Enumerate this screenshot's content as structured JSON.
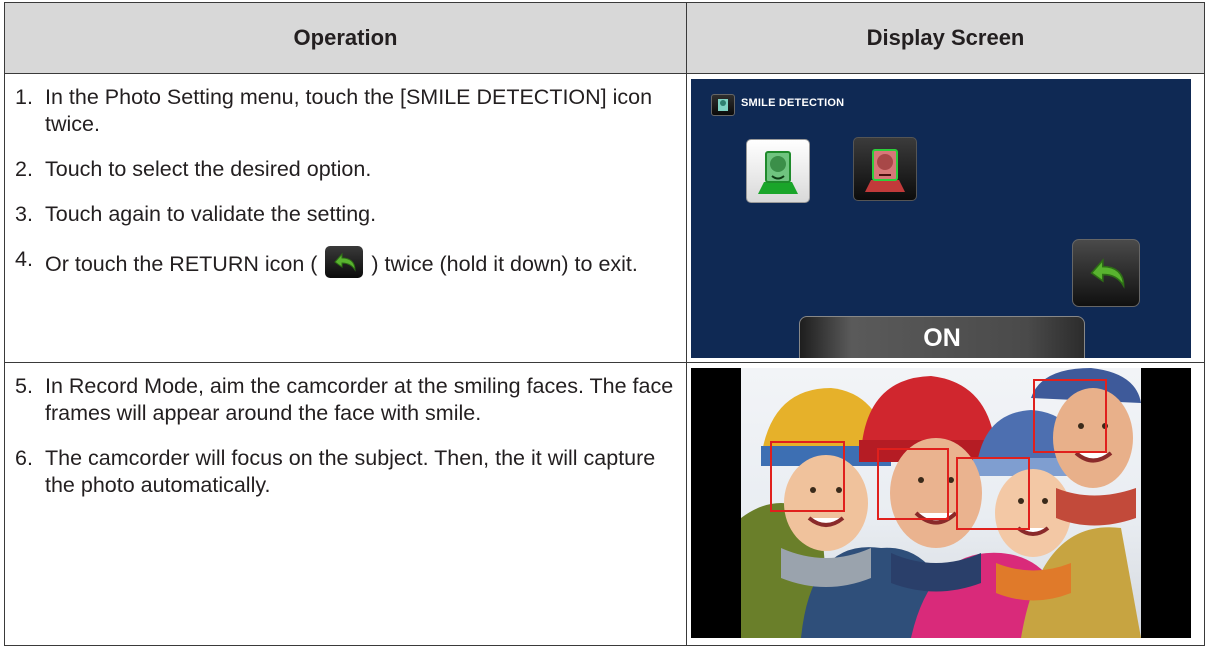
{
  "table": {
    "col_operation": "Operation",
    "col_display": "Display Screen"
  },
  "rows": [
    {
      "steps": [
        {
          "num": "1.",
          "text": "In the Photo Setting menu, touch the [SMILE DETECTION] icon twice."
        },
        {
          "num": "2.",
          "text": "Touch to select the desired option."
        },
        {
          "num": "3.",
          "text": "Touch again to validate the setting."
        },
        {
          "num": "4.",
          "text_before": "Or touch the RETURN icon (",
          "text_after": ") twice (hold it down) to exit.",
          "inline_icon": "return-icon"
        }
      ],
      "screen": {
        "title": "SMILE DETECTION",
        "title_icon": "smile-detection-icon",
        "options": [
          "smile-on-icon",
          "smile-off-icon"
        ],
        "return_icon": "return-icon",
        "value": "ON",
        "bg_color": "#0f2954"
      }
    },
    {
      "steps": [
        {
          "num": "5.",
          "text": "In Record Mode, aim the camcorder at the smiling faces. The face frames will appear around the face with smile."
        },
        {
          "num": "6.",
          "text": "The camcorder will focus on the subject. Then, the it will capture the photo automatically."
        }
      ],
      "photo": {
        "subject": "family-photo",
        "frame_color": "#e0201d",
        "face_frames": 4
      }
    }
  ]
}
